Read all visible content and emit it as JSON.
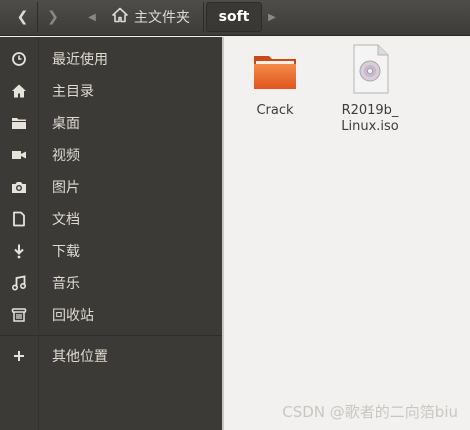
{
  "header": {
    "home_crumb": "主文件夹",
    "current_crumb": "soft"
  },
  "sidebar": {
    "items": [
      {
        "label": "最近使用",
        "icon": "clock-icon"
      },
      {
        "label": "主目录",
        "icon": "home-icon"
      },
      {
        "label": "桌面",
        "icon": "folder-icon"
      },
      {
        "label": "视频",
        "icon": "video-icon"
      },
      {
        "label": "图片",
        "icon": "camera-icon"
      },
      {
        "label": "文档",
        "icon": "document-icon"
      },
      {
        "label": "下载",
        "icon": "download-icon"
      },
      {
        "label": "音乐",
        "icon": "music-icon"
      },
      {
        "label": "回收站",
        "icon": "trash-icon"
      }
    ],
    "other": {
      "label": "其他位置",
      "icon": "plus-icon"
    }
  },
  "files": [
    {
      "name": "Crack",
      "icon": "folder-icon"
    },
    {
      "name": "R2019b_\nLinux.iso",
      "icon": "disc-image-icon"
    }
  ],
  "watermark": "CSDN @歌者的二向箔biu"
}
